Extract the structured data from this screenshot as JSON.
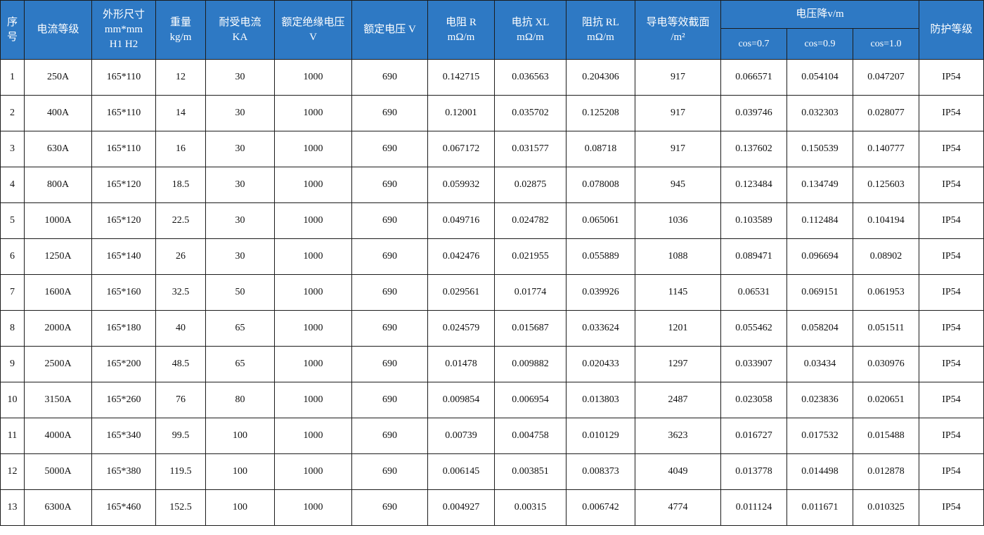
{
  "headers": {
    "seq": "序\n号",
    "rating": "电流等级",
    "size": "外形尺寸\nmm*mm\nH1 H2",
    "weight": "重量\nkg/m",
    "withstand": "耐受电流\nKA",
    "insulation": "额定绝缘电压\nV",
    "voltage": "额定电压 V",
    "resistance": "电阻 R\nmΩ/m",
    "reactance": "电抗 XL\nmΩ/m",
    "impedance": "阻抗 RL\nmΩ/m",
    "section": "导电等效截面\n/m²",
    "drop": "电压降v/m",
    "drop_cols": [
      "cos=0.7",
      "cos=0.9",
      "cos=1.0"
    ],
    "protection": "防护等级"
  },
  "rows": [
    [
      "1",
      "250A",
      "165*110",
      "12",
      "30",
      "1000",
      "690",
      "0.142715",
      "0.036563",
      "0.204306",
      "917",
      "0.066571",
      "0.054104",
      "0.047207",
      "IP54"
    ],
    [
      "2",
      "400A",
      "165*110",
      "14",
      "30",
      "1000",
      "690",
      "0.12001",
      "0.035702",
      "0.125208",
      "917",
      "0.039746",
      "0.032303",
      "0.028077",
      "IP54"
    ],
    [
      "3",
      "630A",
      "165*110",
      "16",
      "30",
      "1000",
      "690",
      "0.067172",
      "0.031577",
      "0.08718",
      "917",
      "0.137602",
      "0.150539",
      "0.140777",
      "IP54"
    ],
    [
      "4",
      "800A",
      "165*120",
      "18.5",
      "30",
      "1000",
      "690",
      "0.059932",
      "0.02875",
      "0.078008",
      "945",
      "0.123484",
      "0.134749",
      "0.125603",
      "IP54"
    ],
    [
      "5",
      "1000A",
      "165*120",
      "22.5",
      "30",
      "1000",
      "690",
      "0.049716",
      "0.024782",
      "0.065061",
      "1036",
      "0.103589",
      "0.112484",
      "0.104194",
      "IP54"
    ],
    [
      "6",
      "1250A",
      "165*140",
      "26",
      "30",
      "1000",
      "690",
      "0.042476",
      "0.021955",
      "0.055889",
      "1088",
      "0.089471",
      "0.096694",
      "0.08902",
      "IP54"
    ],
    [
      "7",
      "1600A",
      "165*160",
      "32.5",
      "50",
      "1000",
      "690",
      "0.029561",
      "0.01774",
      "0.039926",
      "1145",
      "0.06531",
      "0.069151",
      "0.061953",
      "IP54"
    ],
    [
      "8",
      "2000A",
      "165*180",
      "40",
      "65",
      "1000",
      "690",
      "0.024579",
      "0.015687",
      "0.033624",
      "1201",
      "0.055462",
      "0.058204",
      "0.051511",
      "IP54"
    ],
    [
      "9",
      "2500A",
      "165*200",
      "48.5",
      "65",
      "1000",
      "690",
      "0.01478",
      "0.009882",
      "0.020433",
      "1297",
      "0.033907",
      "0.03434",
      "0.030976",
      "IP54"
    ],
    [
      "10",
      "3150A",
      "165*260",
      "76",
      "80",
      "1000",
      "690",
      "0.009854",
      "0.006954",
      "0.013803",
      "2487",
      "0.023058",
      "0.023836",
      "0.020651",
      "IP54"
    ],
    [
      "11",
      "4000A",
      "165*340",
      "99.5",
      "100",
      "1000",
      "690",
      "0.00739",
      "0.004758",
      "0.010129",
      "3623",
      "0.016727",
      "0.017532",
      "0.015488",
      "IP54"
    ],
    [
      "12",
      "5000A",
      "165*380",
      "119.5",
      "100",
      "1000",
      "690",
      "0.006145",
      "0.003851",
      "0.008373",
      "4049",
      "0.013778",
      "0.014498",
      "0.012878",
      "IP54"
    ],
    [
      "13",
      "6300A",
      "165*460",
      "152.5",
      "100",
      "1000",
      "690",
      "0.004927",
      "0.00315",
      "0.006742",
      "4774",
      "0.011124",
      "0.011671",
      "0.010325",
      "IP54"
    ]
  ],
  "colors": {
    "header_bg": "#2e79c4",
    "header_text": "#ffffff",
    "border": "#1c1c1c"
  }
}
